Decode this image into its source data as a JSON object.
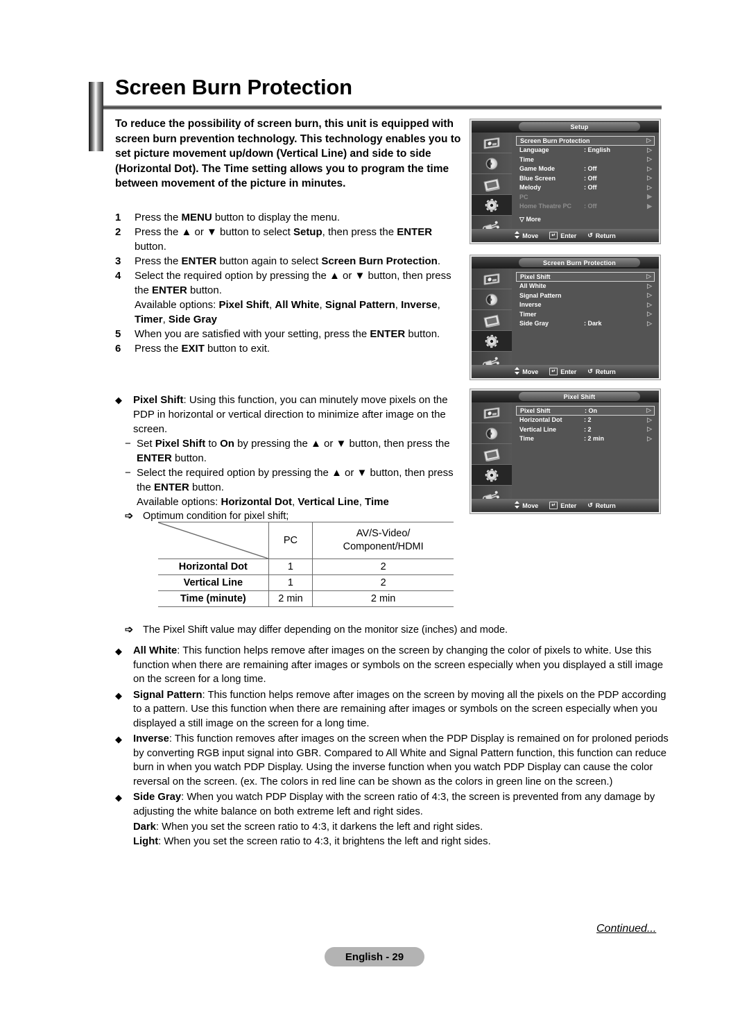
{
  "document": {
    "title": "Screen Burn Protection",
    "intro": "To reduce the possibility of screen burn, this unit is equipped with screen burn prevention technology. This technology enables you to set picture movement up/down (Vertical Line) and side to side (Horizontal Dot). The Time setting allows you to program the time between movement of the picture in minutes."
  },
  "steps": [
    {
      "num": "1",
      "text_html": "Press the <b>MENU</b> button to display the menu."
    },
    {
      "num": "2",
      "text_html": "Press the ▲ or ▼ button to select <b>Setup</b>, then press the <b>ENTER</b> button."
    },
    {
      "num": "3",
      "text_html": "Press the <b>ENTER</b> button again to select <b>Screen Burn Protection</b>."
    },
    {
      "num": "4",
      "text_html": "Select the required option by pressing the ▲ or ▼ button, then press the <b>ENTER</b> button."
    },
    {
      "num": "",
      "text_html": "Available options: <b>Pixel Shift</b>, <b>All White</b>, <b>Signal Pattern</b>, <b>Inverse</b>, <b>Timer</b>, <b>Side Gray</b>"
    },
    {
      "num": "5",
      "text_html": "When you are satisfied with your setting, press the <b>ENTER</b> button."
    },
    {
      "num": "6",
      "text_html": "Press the <b>EXIT</b> button to exit."
    }
  ],
  "pixel_shift_section": {
    "bullet_html": "<b>Pixel Shift</b>: Using this function, you can minutely move pixels on the PDP in horizontal or vertical direction to minimize after image on the screen.",
    "dashes": [
      "Set <b>Pixel Shift</b> to <b>On</b> by pressing the ▲ or ▼ button, then press the <b>ENTER</b> button.",
      "Select the required option by pressing the ▲ or ▼ button, then press the <b>ENTER</b> button.<br>Available options: <b>Horizontal Dot</b>, <b>Vertical Line</b>, <b>Time</b>"
    ],
    "arrow_note": "Optimum condition for pixel shift;"
  },
  "spec_table": {
    "col_headers": [
      "PC",
      "AV/S-Video/\nComponent/HDMI"
    ],
    "col_header_pc": "PC",
    "col_header_av_line1": "AV/S-Video/",
    "col_header_av_line2": "Component/HDMI",
    "rows": [
      {
        "label": "Horizontal Dot",
        "pc": "1",
        "av": "2"
      },
      {
        "label": "Vertical Line",
        "pc": "1",
        "av": "2"
      },
      {
        "label": "Time (minute)",
        "pc": "2 min",
        "av": "2 min"
      }
    ],
    "note": "The Pixel Shift value may differ depending on the monitor size (inches) and mode."
  },
  "descriptions": [
    {
      "html": "<b>All White</b>: This function helps remove after images on the screen by changing the color of pixels to white. Use this function when there are remaining after images or symbols on the screen especially when you displayed a still image on the screen for a long time."
    },
    {
      "html": "<b>Signal Pattern</b>: This function helps remove after images on the screen by moving all the pixels on the PDP according to a pattern. Use this function when there are remaining after images or symbols on the screen especially when you displayed a still image on the screen for a long time."
    },
    {
      "html": "<b>Inverse</b>: This function removes after images on the screen when the PDP Display is remained on for proloned periods by converting RGB input signal into GBR. Compared to All White and Signal Pattern function, this function can reduce burn in when you watch PDP Display. Using the inverse function when you watch PDP Display can cause the color reversal on the screen. (ex. The colors in red line can be shown as the colors in green line on the screen.)"
    },
    {
      "html": "<b>Side Gray</b>: When you watch PDP Display with the screen ratio of 4:3, the screen is prevented from any damage by adjusting the white balance on both extreme left and right sides."
    }
  ],
  "side_gray_extra": [
    {
      "html": "<b>Dark</b>: When you set the screen ratio to 4:3, it darkens the left and right sides."
    },
    {
      "html": "<b>Light</b>: When you set the screen ratio to 4:3, it brightens the left and right sides."
    }
  ],
  "footer": {
    "continued": "Continued...",
    "page_label": "English - 29"
  },
  "osd_common": {
    "move": "Move",
    "enter": "Enter",
    "return": "Return",
    "arrow_glyph": "▷",
    "arrow_glyph_solid": "▶",
    "more_glyph": "▽",
    "more_label": "More",
    "sidebar_icons": [
      "picture-icon",
      "sound-icon",
      "channel-icon",
      "setup-icon",
      "input-icon"
    ],
    "active_sidebar_index": 3
  },
  "osd_panels": [
    {
      "title": "Setup",
      "rows": [
        {
          "label": "Screen Burn Protection",
          "value": "",
          "selected": true,
          "dim": false,
          "arrow": "▷"
        },
        {
          "label": "Language",
          "value": ": English",
          "selected": false,
          "dim": false,
          "arrow": "▷"
        },
        {
          "label": "Time",
          "value": "",
          "selected": false,
          "dim": false,
          "arrow": "▷"
        },
        {
          "label": "Game Mode",
          "value": ": Off",
          "selected": false,
          "dim": false,
          "arrow": "▷"
        },
        {
          "label": "Blue Screen",
          "value": ": Off",
          "selected": false,
          "dim": false,
          "arrow": "▷"
        },
        {
          "label": "Melody",
          "value": ": Off",
          "selected": false,
          "dim": false,
          "arrow": "▷"
        },
        {
          "label": "PC",
          "value": "",
          "selected": false,
          "dim": true,
          "arrow": "▶"
        },
        {
          "label": "Home Theatre PC",
          "value": ": Off",
          "selected": false,
          "dim": true,
          "arrow": "▶"
        }
      ],
      "show_more": true
    },
    {
      "title": "Screen Burn Protection",
      "rows": [
        {
          "label": "Pixel Shift",
          "value": "",
          "selected": true,
          "dim": false,
          "arrow": "▷"
        },
        {
          "label": "All White",
          "value": "",
          "selected": false,
          "dim": false,
          "arrow": "▷"
        },
        {
          "label": "Signal Pattern",
          "value": "",
          "selected": false,
          "dim": false,
          "arrow": "▷"
        },
        {
          "label": "Inverse",
          "value": "",
          "selected": false,
          "dim": false,
          "arrow": "▷"
        },
        {
          "label": "Timer",
          "value": "",
          "selected": false,
          "dim": false,
          "arrow": "▷"
        },
        {
          "label": "Side Gray",
          "value": ": Dark",
          "selected": false,
          "dim": false,
          "arrow": "▷"
        }
      ],
      "show_more": false
    },
    {
      "title": "Pixel Shift",
      "rows": [
        {
          "label": "Pixel Shift",
          "value": ": On",
          "selected": true,
          "dim": false,
          "arrow": "▷"
        },
        {
          "label": "Horizontal Dot",
          "value": ": 2",
          "selected": false,
          "dim": false,
          "arrow": "▷"
        },
        {
          "label": "Vertical Line",
          "value": ": 2",
          "selected": false,
          "dim": false,
          "arrow": "▷"
        },
        {
          "label": "Time",
          "value": ": 2  min",
          "selected": false,
          "dim": false,
          "arrow": "▷"
        }
      ],
      "show_more": false
    }
  ]
}
